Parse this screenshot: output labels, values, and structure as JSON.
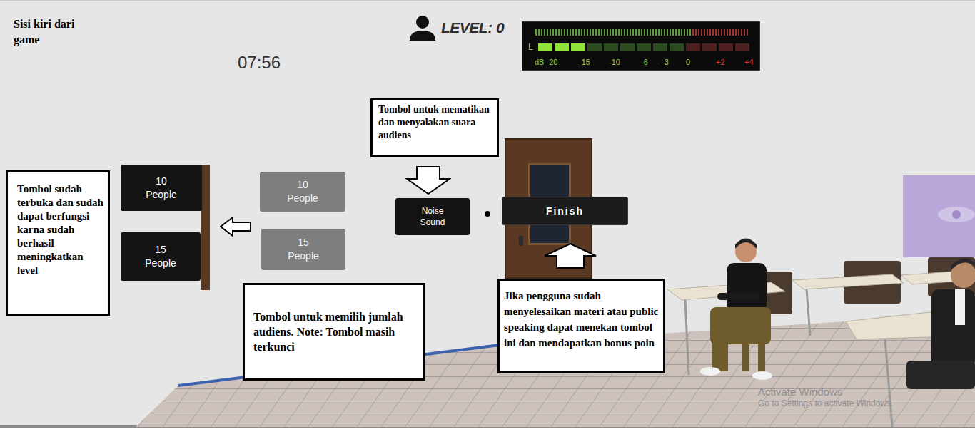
{
  "caption": "Sisi kiri dari game",
  "hud": {
    "timer": "07:56",
    "level_label": "LEVEL: 0"
  },
  "meter": {
    "channel": "L",
    "level": 0.23,
    "scale": [
      {
        "label": "dB -20",
        "color": "#8fd14f"
      },
      {
        "label": "-15",
        "color": "#8fd14f"
      },
      {
        "label": "-10",
        "color": "#8fd14f"
      },
      {
        "label": "-6",
        "color": "#8fd14f"
      },
      {
        "label": "-3",
        "color": "#8fd14f"
      },
      {
        "label": "0",
        "color": "#8fd14f"
      },
      {
        "label": "+2",
        "color": "#e03a3a"
      },
      {
        "label": "+4",
        "color": "#e03a3a"
      }
    ]
  },
  "unlocked_buttons": [
    {
      "label": "10 People",
      "locked": false
    },
    {
      "label": "15 People",
      "locked": false
    }
  ],
  "locked_buttons": [
    {
      "label": "10 People",
      "locked": true
    },
    {
      "label": "15 People",
      "locked": true
    }
  ],
  "noise_button": {
    "label": "Noise Sound"
  },
  "finish_button": {
    "label": "Finish"
  },
  "annotations": [
    {
      "text": "Tombol untuk mematikan dan menyalakan suara audiens"
    },
    {
      "text": "Tombol sudah terbuka dan sudah dapat berfungsi karna sudah berhasil meningkatkan level"
    },
    {
      "text": "Tombol untuk memilih jumlah audiens. Note: Tombol masih terkunci"
    },
    {
      "text": "Jika pengguna sudah menyelesaikan materi atau public speaking dapat menekan tombol ini dan mendapatkan bonus poin"
    }
  ],
  "watermark": {
    "title": "Activate Windows",
    "subtitle": "Go to Settings to activate Windows."
  }
}
